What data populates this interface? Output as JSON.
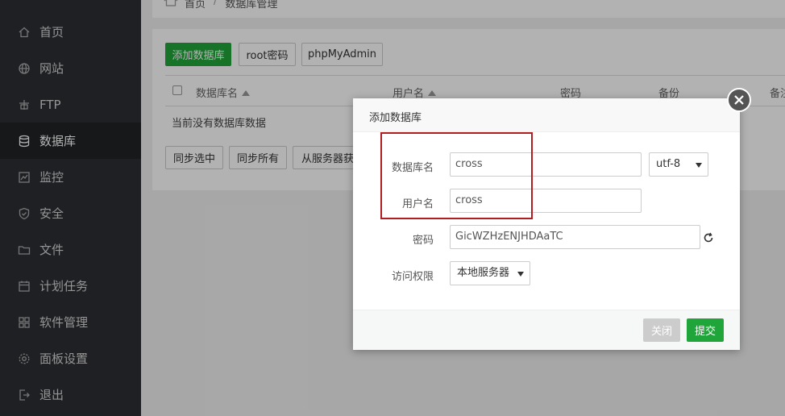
{
  "sidebar": {
    "items": [
      {
        "label": "首页",
        "icon": "home-icon"
      },
      {
        "label": "网站",
        "icon": "globe-icon"
      },
      {
        "label": "FTP",
        "icon": "ftp-icon"
      },
      {
        "label": "数据库",
        "icon": "database-icon",
        "active": true
      },
      {
        "label": "监控",
        "icon": "monitor-icon"
      },
      {
        "label": "安全",
        "icon": "shield-icon"
      },
      {
        "label": "文件",
        "icon": "folder-icon"
      },
      {
        "label": "计划任务",
        "icon": "calendar-icon"
      },
      {
        "label": "软件管理",
        "icon": "grid-icon"
      },
      {
        "label": "面板设置",
        "icon": "gear-icon"
      },
      {
        "label": "退出",
        "icon": "logout-icon"
      }
    ]
  },
  "breadcrumb": {
    "home": "首页",
    "current": "数据库管理"
  },
  "toolbar": {
    "add_db": "添加数据库",
    "root_pwd": "root密码",
    "phpmyadmin": "phpMyAdmin"
  },
  "table": {
    "headers": [
      "数据库名",
      "用户名",
      "密码",
      "备份",
      "备注"
    ],
    "empty_text": "当前没有数据库数据"
  },
  "bottom_toolbar": {
    "sync_selected": "同步选中",
    "sync_all": "同步所有",
    "fetch_from_server": "从服务器获取"
  },
  "modal": {
    "title": "添加数据库",
    "fields": {
      "db_name_label": "数据库名",
      "db_name_value": "cross",
      "charset": "utf-8",
      "username_label": "用户名",
      "username_value": "cross",
      "password_label": "密码",
      "password_value": "GicWZHzENJHDAaTC",
      "access_label": "访问权限",
      "access_value": "本地服务器"
    },
    "close_label": "关闭",
    "submit_label": "提交"
  },
  "colors": {
    "sidebar_bg": "#2b2f33",
    "accent_green": "#20a53a",
    "highlight_red": "#b11e22"
  }
}
